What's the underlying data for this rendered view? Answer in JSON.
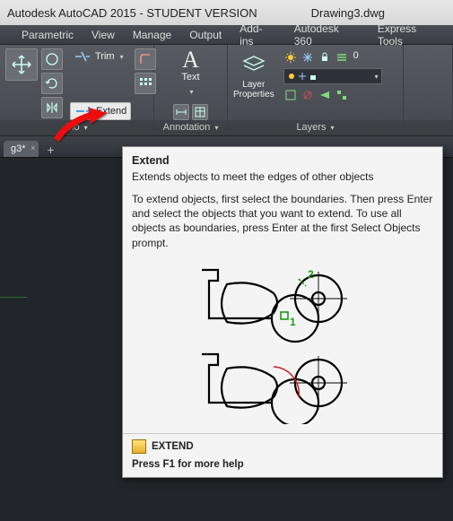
{
  "titlebar": {
    "app": "Autodesk AutoCAD 2015 - STUDENT VERSION",
    "doc": "Drawing3.dwg"
  },
  "menubar": {
    "items": [
      "",
      "Parametric",
      "View",
      "Manage",
      "Output",
      "Add-ins",
      "Autodesk 360",
      "Express Tools"
    ]
  },
  "ribbon": {
    "modify": {
      "label": "Mo",
      "trim": "Trim",
      "extend": "Extend"
    },
    "annotation": {
      "label": "Annotation",
      "text": "Text"
    },
    "layers": {
      "label": "Layers",
      "props": "Layer\nProperties",
      "current": "0"
    }
  },
  "tabs": {
    "doc": "g3*"
  },
  "tooltip": {
    "title": "Extend",
    "subtitle": "Extends objects to meet the edges of other objects",
    "body": "To extend objects, first select the boundaries. Then press Enter and select the objects that you want to extend. To use all objects as boundaries, press Enter at the first Select Objects prompt.",
    "cmd": "EXTEND",
    "help": "Press F1 for more help"
  },
  "illus": {
    "n1": "1",
    "n2": "2"
  }
}
